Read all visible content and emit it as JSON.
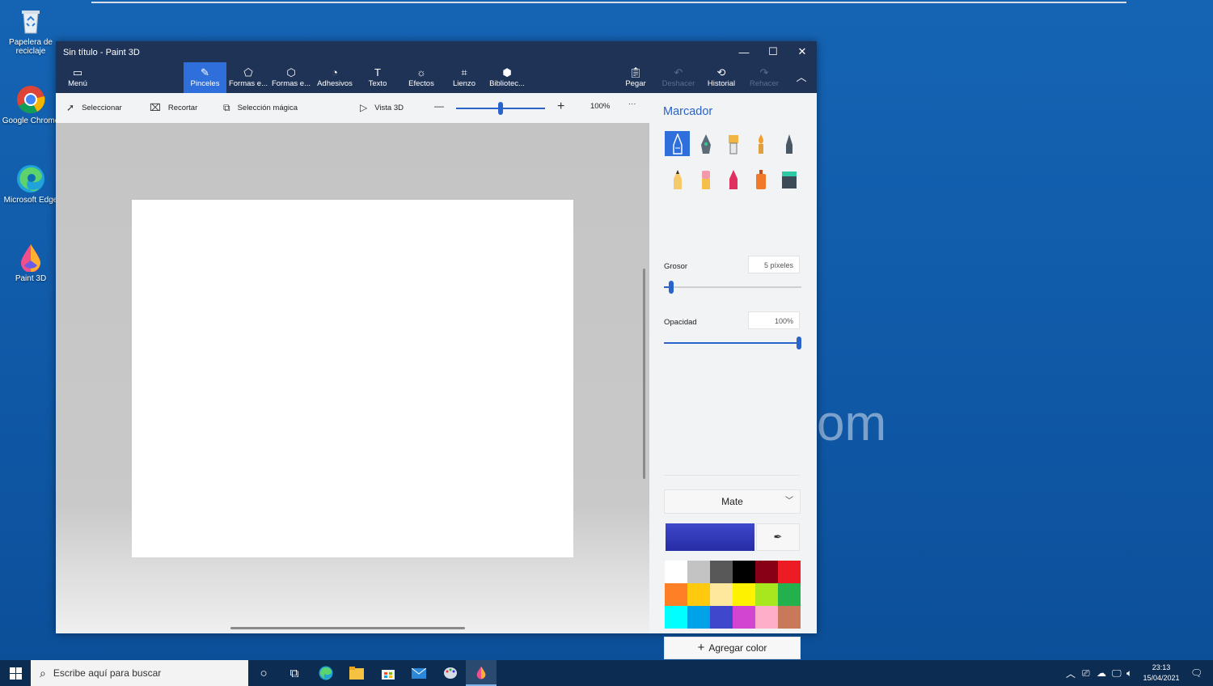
{
  "desktop": {
    "icons": [
      {
        "label": "Papelera de reciclaje",
        "icon": "recycle-bin-icon"
      },
      {
        "label": "Google Chrome",
        "icon": "chrome-icon"
      },
      {
        "label": "Microsoft Edge",
        "icon": "edge-icon"
      },
      {
        "label": "Paint 3D",
        "icon": "paint3d-icon"
      }
    ],
    "watermark": "om"
  },
  "window": {
    "title": "Sin título - Paint 3D",
    "controls": {
      "minimize": "—",
      "maximize": "☐",
      "close": "✕"
    }
  },
  "ribbon": {
    "menu": "Menú",
    "tools": [
      "Pinceles",
      "Formas e...",
      "Formas e...",
      "Adhesivos",
      "Texto",
      "Efectos",
      "Lienzo",
      "Bibliotec..."
    ],
    "active_tool": "Pinceles",
    "actions": [
      "Pegar",
      "Deshacer",
      "Historial",
      "Rehacer"
    ]
  },
  "toolbar": {
    "select": "Seleccionar",
    "crop": "Recortar",
    "magic_select": "Selección mágica",
    "view3d": "Vista 3D",
    "zoom": "100%",
    "zoom_level": 0.5,
    "more": "···"
  },
  "panel": {
    "title": "Marcador",
    "brushes": [
      "marker",
      "calligraphy-pen",
      "oil-brush",
      "watercolor",
      "pixel-pen",
      "pencil",
      "eraser",
      "crayon",
      "spray-can",
      "fill"
    ],
    "selected_brush": "marker",
    "thickness_label": "Grosor",
    "thickness_value": "5 píxeles",
    "thickness_level": 0.05,
    "opacity_label": "Opacidad",
    "opacity_value": "100%",
    "opacity_level": 1.0,
    "finish": "Mate",
    "current_color": "#3f48cc",
    "palette": [
      "#ffffff",
      "#c3c3c3",
      "#585858",
      "#000000",
      "#880015",
      "#ed1c24",
      "#ff7f27",
      "#ffc90e",
      "#fde89d",
      "#fff200",
      "#a8e61d",
      "#22b14c",
      "#00ffff",
      "#00a2e8",
      "#3f48cc",
      "#d145d1",
      "#ffaec9",
      "#c8795a"
    ],
    "add_color": "Agregar color"
  },
  "taskbar": {
    "search_placeholder": "Escribe aquí para buscar",
    "time": "23:13",
    "date": "15/04/2021"
  }
}
